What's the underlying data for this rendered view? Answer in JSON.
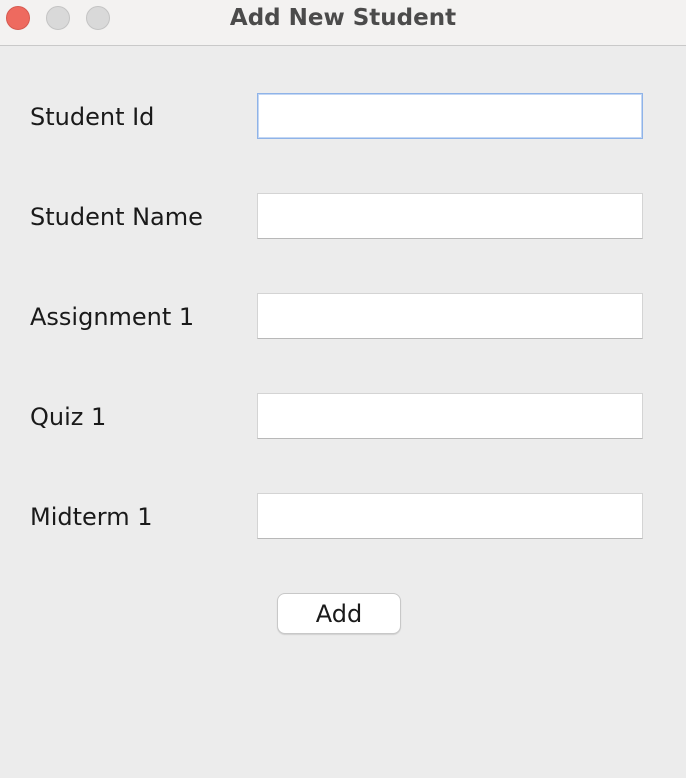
{
  "window": {
    "title": "Add New Student"
  },
  "form": {
    "fields": [
      {
        "label": "Student Id",
        "value": "",
        "placeholder": ""
      },
      {
        "label": "Student Name",
        "value": "",
        "placeholder": ""
      },
      {
        "label": "Assignment 1",
        "value": "",
        "placeholder": ""
      },
      {
        "label": "Quiz 1",
        "value": "",
        "placeholder": ""
      },
      {
        "label": "Midterm 1",
        "value": "",
        "placeholder": ""
      }
    ],
    "submit_label": "Add"
  },
  "colors": {
    "close_button": "#ee6a5f",
    "focus_ring": "#8fb3e8",
    "background": "#ececec"
  }
}
